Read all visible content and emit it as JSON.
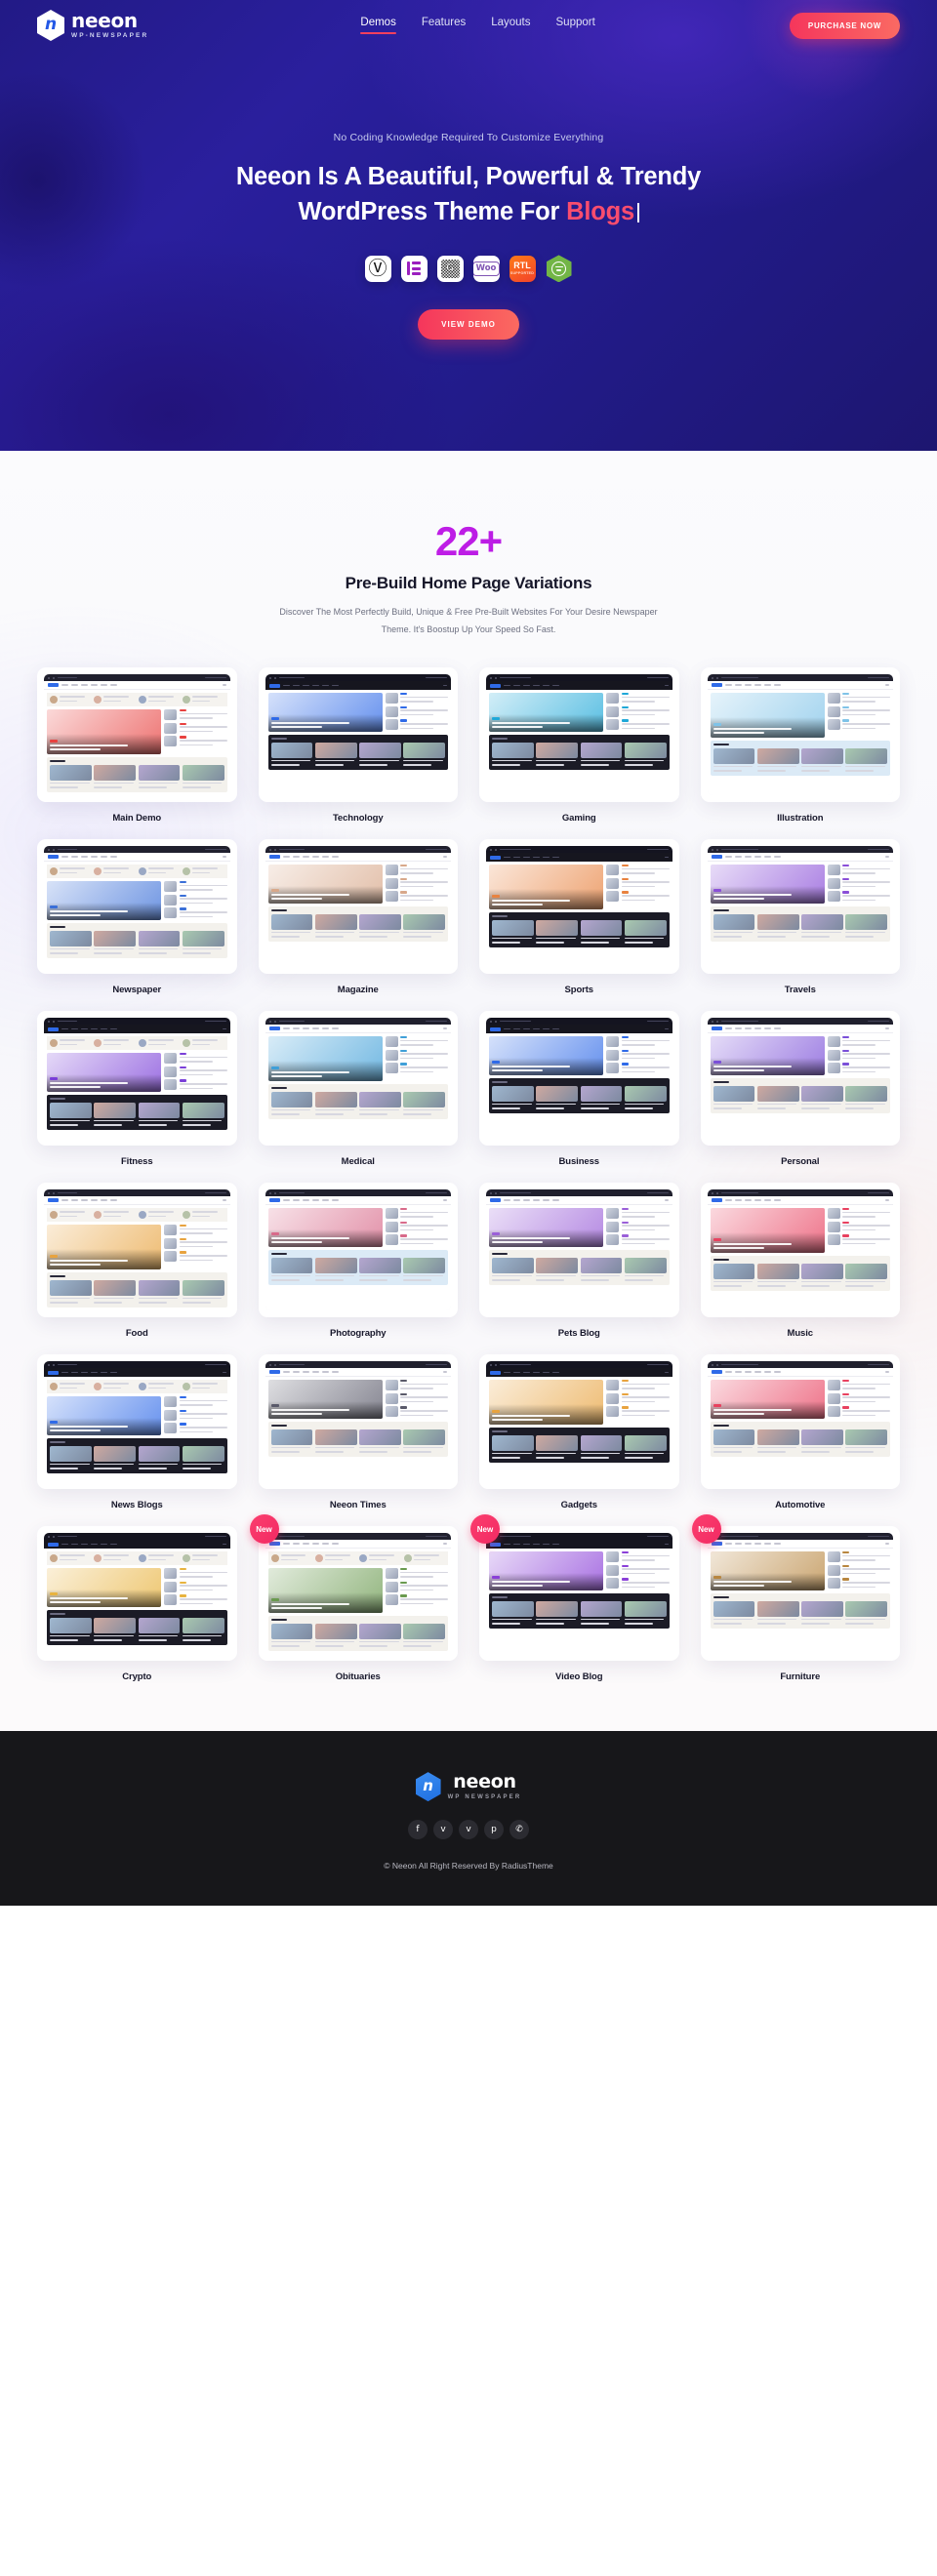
{
  "brand": {
    "name": "neeon",
    "tagline": "WP-NEWSPAPER",
    "footer_tagline": "WP NEWSPAPER",
    "mark_letter": "n",
    "accent_pink": "#f5365c",
    "accent_purple": "#a21ce0",
    "accent_blue": "#2358e6"
  },
  "nav": {
    "items": [
      {
        "label": "Demos",
        "active": true
      },
      {
        "label": "Features",
        "active": false
      },
      {
        "label": "Layouts",
        "active": false
      },
      {
        "label": "Support",
        "active": false
      }
    ],
    "purchase_label": "PURCHASE NOW"
  },
  "hero": {
    "eyebrow": "No Coding Knowledge Required To Customize Everything",
    "title_line1": "Neeon Is A Beautiful, Powerful & Trendy",
    "title_line2_prefix": "WordPress Theme For ",
    "title_line2_accent": "Blogs",
    "cta_label": "VIEW DEMO",
    "badges": [
      {
        "name": "wordpress-badge",
        "label": "W"
      },
      {
        "name": "elementor-badge",
        "label": "Elementor"
      },
      {
        "name": "gutenberg-badge",
        "label": "G"
      },
      {
        "name": "woocommerce-badge",
        "label": "Woo"
      },
      {
        "name": "rtl-badge",
        "label_top": "RTL",
        "label_bottom": "SUPPORTED"
      },
      {
        "name": "jetengine-badge",
        "label": "Hex"
      }
    ]
  },
  "demos": {
    "count": "22+",
    "title": "Pre-Build Home Page Variations",
    "description": "Discover The Most Perfectly Build, Unique & Free Pre-Built Websites For Your Desire Newspaper Theme. It's Boostup Up Your Speed So Fast.",
    "new_badge_label": "New",
    "items": [
      {
        "label": "Main Demo",
        "is_new": false,
        "theme": "light",
        "accent": "#e8413f"
      },
      {
        "label": "Technology",
        "is_new": false,
        "theme": "dark",
        "accent": "#2f6ae8"
      },
      {
        "label": "Gaming",
        "is_new": false,
        "theme": "dark",
        "accent": "#1fa8d8"
      },
      {
        "label": "Illustration",
        "is_new": false,
        "theme": "pastel",
        "accent": "#7fc3e8"
      },
      {
        "label": "Newspaper",
        "is_new": false,
        "theme": "light",
        "accent": "#3a6fd8"
      },
      {
        "label": "Magazine",
        "is_new": false,
        "theme": "light",
        "accent": "#d8a88a"
      },
      {
        "label": "Sports",
        "is_new": false,
        "theme": "dark",
        "accent": "#e8823f"
      },
      {
        "label": "Travels",
        "is_new": false,
        "theme": "light",
        "accent": "#8a4fd8"
      },
      {
        "label": "Fitness",
        "is_new": false,
        "theme": "dark",
        "accent": "#7a3fd8"
      },
      {
        "label": "Medical",
        "is_new": false,
        "theme": "light",
        "accent": "#3f9fd8"
      },
      {
        "label": "Business",
        "is_new": false,
        "theme": "dark",
        "accent": "#2f6ae8"
      },
      {
        "label": "Personal",
        "is_new": false,
        "theme": "light",
        "accent": "#7a4fd8"
      },
      {
        "label": "Food",
        "is_new": false,
        "theme": "light",
        "accent": "#e8a33f"
      },
      {
        "label": "Photography",
        "is_new": false,
        "theme": "pastel",
        "accent": "#d86a8a"
      },
      {
        "label": "Pets Blog",
        "is_new": false,
        "theme": "light",
        "accent": "#9a5fd8"
      },
      {
        "label": "Music",
        "is_new": false,
        "theme": "light",
        "accent": "#e8415f"
      },
      {
        "label": "News Blogs",
        "is_new": false,
        "theme": "dark",
        "accent": "#2f6ae8"
      },
      {
        "label": "Neeon Times",
        "is_new": false,
        "theme": "light",
        "accent": "#5a5a6a"
      },
      {
        "label": "Gadgets",
        "is_new": false,
        "theme": "dark",
        "accent": "#e8a33f"
      },
      {
        "label": "Automotive",
        "is_new": false,
        "theme": "light",
        "accent": "#e8415f"
      },
      {
        "label": "Crypto",
        "is_new": false,
        "theme": "dark",
        "accent": "#e8b33f"
      },
      {
        "label": "Obituaries",
        "is_new": true,
        "theme": "light",
        "accent": "#6a9a4f"
      },
      {
        "label": "Video Blog",
        "is_new": true,
        "theme": "dark",
        "accent": "#8a3fd8"
      },
      {
        "label": "Furniture",
        "is_new": true,
        "theme": "light",
        "accent": "#b8863f"
      }
    ]
  },
  "footer": {
    "socials": [
      {
        "name": "facebook-icon",
        "glyph": "f"
      },
      {
        "name": "twitter-icon",
        "glyph": "ᴠ"
      },
      {
        "name": "vimeo-icon",
        "glyph": "v"
      },
      {
        "name": "pinterest-icon",
        "glyph": "р"
      },
      {
        "name": "whatsapp-icon",
        "glyph": "✆"
      }
    ],
    "copyright": "© Neeon All Right Reserved By RadiusTheme"
  }
}
